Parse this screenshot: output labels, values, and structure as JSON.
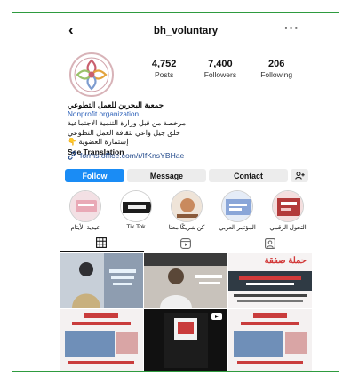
{
  "header": {
    "back_icon": "chevron-left-icon",
    "username": "bh_voluntary",
    "more_icon": "more-horizontal-icon"
  },
  "profile": {
    "stats": {
      "posts_count": "4,752",
      "posts_label": "Posts",
      "followers_count": "7,400",
      "followers_label": "Followers",
      "following_count": "206",
      "following_label": "Following"
    }
  },
  "bio": {
    "name": "جمعية البحرين للعمل التطوعي",
    "category": "Nonprofit organization",
    "line1": "مرخصة من قبل وزارة التنمية الاجتماعية",
    "line2": "خلق جيل واعي بثقافة العمل التطوعي",
    "line3": "إستمارة العضوية 👇",
    "see_translation": "See Translation",
    "link": "forms.office.com/r/IfKnsYBHae"
  },
  "actions": {
    "follow": "Follow",
    "message": "Message",
    "contact": "Contact",
    "add_user_icon": "add-user-icon"
  },
  "highlights": [
    {
      "label": "عيدية الأيتام",
      "color": "#e9a9b6"
    },
    {
      "label": "Tik Tok",
      "color": "#1d1d1d"
    },
    {
      "label": "كن شريكًا معنا",
      "color": "#c98a5e"
    },
    {
      "label": "المؤتمر العربي",
      "color": "#8aa6d8"
    },
    {
      "label": "التحول الرقمي",
      "color": "#b33a3a"
    }
  ],
  "tabs": [
    {
      "name": "grid",
      "icon": "grid-icon"
    },
    {
      "name": "reels",
      "icon": "reels-icon"
    },
    {
      "name": "tagged",
      "icon": "tagged-icon"
    }
  ],
  "posts": [
    {
      "caption": "",
      "accent": "#7a8fa6"
    },
    {
      "caption": "",
      "accent": "#5c5c5c"
    },
    {
      "caption": "حملة صفقة",
      "accent": "#d23a3a"
    },
    {
      "caption": "",
      "accent": "#c93c3c"
    },
    {
      "caption": "",
      "accent": "#111111"
    },
    {
      "caption": "",
      "accent": "#c93c3c"
    }
  ],
  "colors": {
    "frame": "#2e9b3f",
    "follow": "#1a8cf5",
    "link": "#244b8c",
    "category": "#2a5fb8"
  }
}
